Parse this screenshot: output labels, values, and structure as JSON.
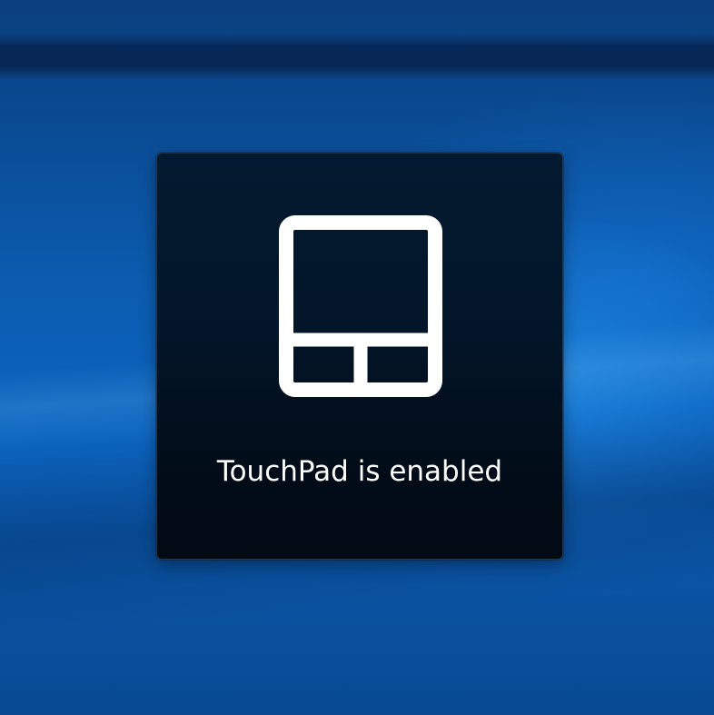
{
  "osd": {
    "message": "TouchPad is enabled",
    "icon": "touchpad-icon"
  },
  "colors": {
    "panel_background": "#03162a",
    "icon": "#ffffff",
    "text": "#ffffff",
    "wallpaper_accent": "#0b63bd"
  }
}
